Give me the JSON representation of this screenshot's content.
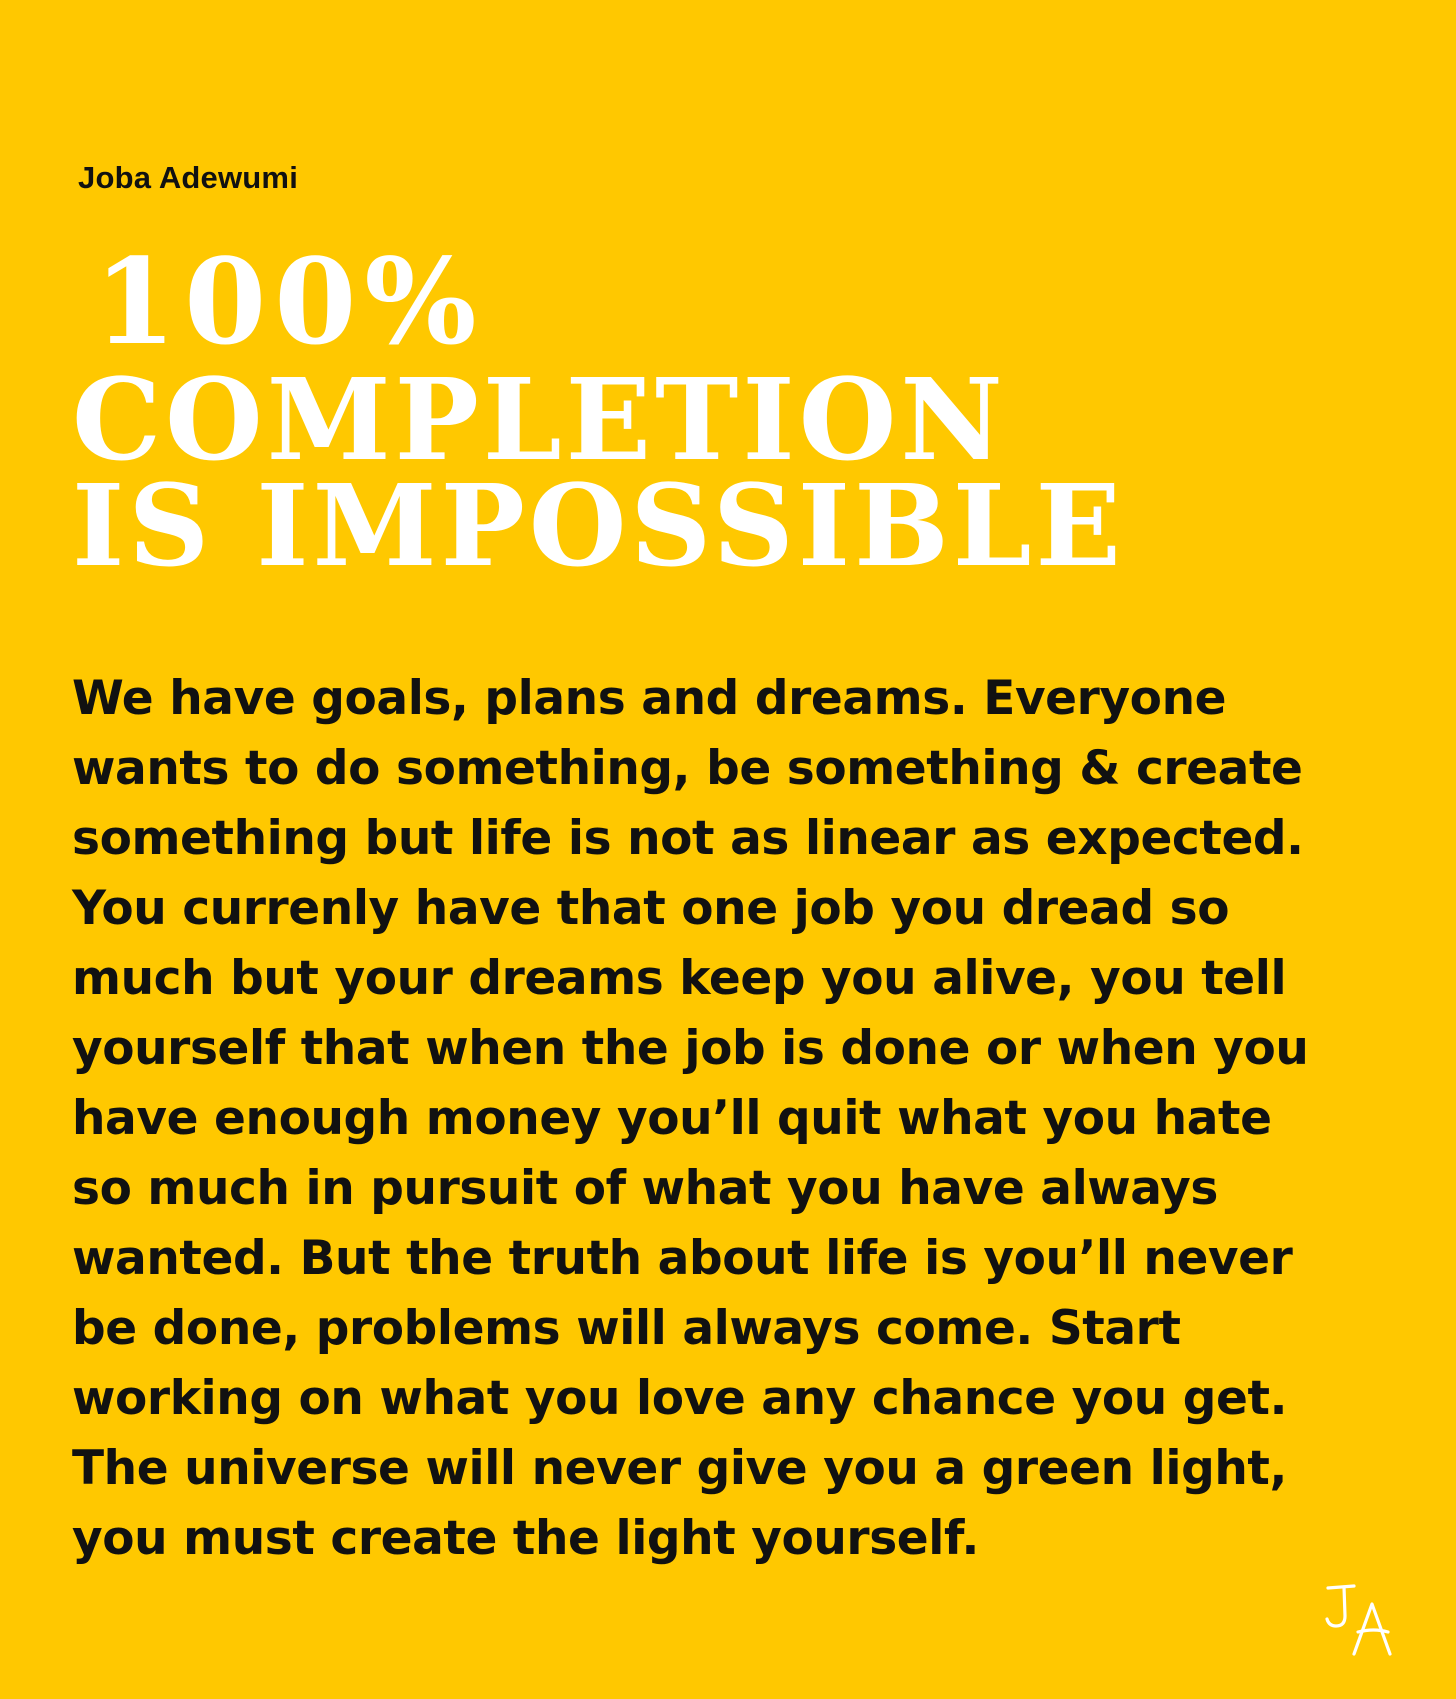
{
  "author": "Joba Adewumi",
  "headline": {
    "lines": [
      "100%",
      "COMPLETION",
      "IS IMPOSSIBLE"
    ]
  },
  "body": {
    "lines": [
      "We have goals, plans and dreams. Everyone",
      "wants to do something, be something & create",
      "something but life is not as linear as expected.",
      "You currenly have that one job you dread so",
      "much but your dreams keep you alive, you tell",
      "yourself that when the job is done or when you",
      "have enough money you’ll quit what you hate",
      "so much in pursuit of what you have always",
      "wanted. But the truth about life is you’ll never",
      "be done, problems will always come. Start",
      "working on what you love any chance you get.",
      "The universe will never give you a green light,",
      "you must create the light yourself."
    ]
  },
  "signature": {
    "text": "JA",
    "icon": "ja-signature-mark"
  },
  "colors": {
    "background": "#FFC800",
    "headline": "#FFFFFF",
    "text": "#111111",
    "signature": "#FFFFFF"
  }
}
